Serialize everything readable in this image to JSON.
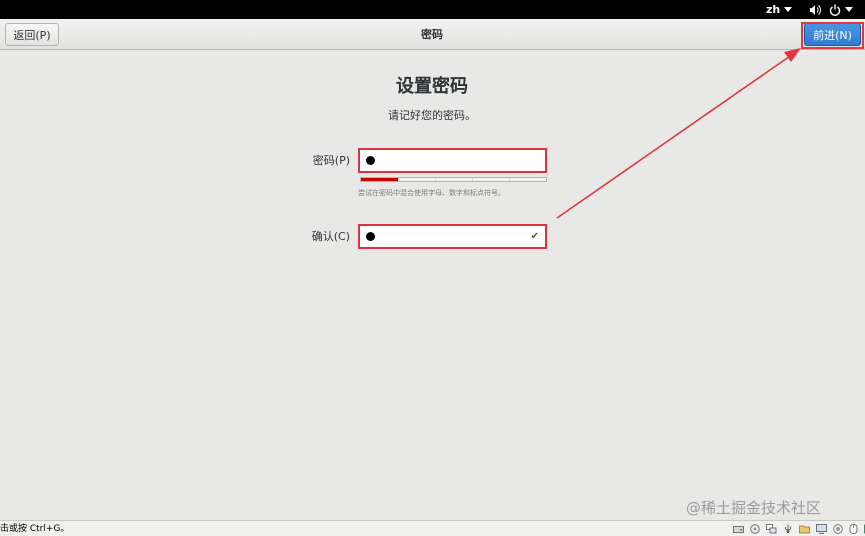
{
  "topbar": {
    "language": "zh",
    "icons": [
      "volume-icon",
      "power-icon",
      "system-menu-caret-icon"
    ]
  },
  "header": {
    "back_button": "返回(P)",
    "title": "密码",
    "next_button": "前进(N)"
  },
  "page": {
    "title": "设置密码",
    "subtitle": "请记好您的密码。",
    "password_label": "密码(P)",
    "password_value": "●",
    "strength_level": 0.2,
    "hint": "尝试在密码中混合使用字母、数字和标点符号。",
    "confirm_label": "确认(C)",
    "confirm_value": "●",
    "confirm_check": "✔"
  },
  "colors": {
    "accent": "#3584e4",
    "highlight": "#e0383e",
    "strength_fill": "#cc0000"
  },
  "watermark": "@稀土掘金技术社区",
  "statusbar": {
    "text": "击或按 Ctrl+G。",
    "tray_icons": [
      "hdd-icon",
      "cd-icon",
      "network-icon",
      "usb-icon",
      "shared-folder-icon",
      "display-icon",
      "record-icon",
      "mouse-icon",
      "keyboard-icon"
    ]
  }
}
